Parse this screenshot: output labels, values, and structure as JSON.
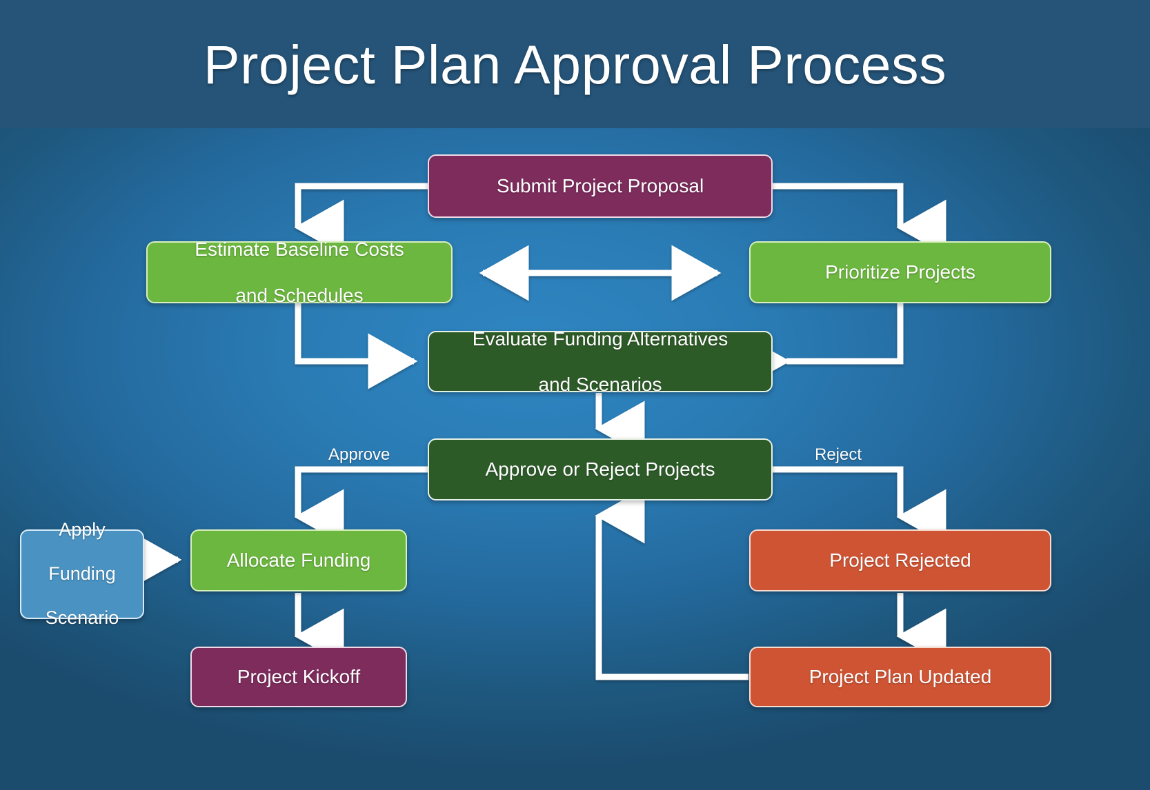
{
  "header": {
    "title": "Project Plan Approval Process",
    "band_color": "#255478",
    "title_color": "#ffffff"
  },
  "canvas": {
    "background_color": "#2a7bb4",
    "connector_color": "#ffffff"
  },
  "palette": {
    "purple": "#7d2c5c",
    "green": "#6cb73f",
    "dark_green": "#2d5b28",
    "orange": "#cf5434",
    "light_blue": "#4a92c2"
  },
  "nodes": [
    {
      "id": "submit",
      "label": "Submit Project Proposal",
      "color_key": "purple"
    },
    {
      "id": "estimate",
      "label": "Estimate Baseline Costs\nand Schedules",
      "color_key": "green"
    },
    {
      "id": "prioritize",
      "label": "Prioritize Projects",
      "color_key": "green"
    },
    {
      "id": "evaluate",
      "label": "Evaluate Funding Alternatives\nand Scenarios",
      "color_key": "dark_green"
    },
    {
      "id": "decide",
      "label": "Approve or Reject Projects",
      "color_key": "dark_green"
    },
    {
      "id": "scenario",
      "label": "Apply\nFunding\nScenario",
      "color_key": "light_blue"
    },
    {
      "id": "allocate",
      "label": "Allocate Funding",
      "color_key": "green"
    },
    {
      "id": "kickoff",
      "label": "Project Kickoff",
      "color_key": "purple"
    },
    {
      "id": "rejected",
      "label": "Project Rejected",
      "color_key": "orange"
    },
    {
      "id": "updated",
      "label": "Project Plan Updated",
      "color_key": "orange"
    }
  ],
  "node_labels": {
    "submit": "Submit Project Proposal",
    "estimate_line1": "Estimate Baseline Costs",
    "estimate_line2": "and Schedules",
    "prioritize": "Prioritize Projects",
    "evaluate_line1": "Evaluate Funding Alternatives",
    "evaluate_line2": "and Scenarios",
    "decide": "Approve or Reject Projects",
    "scenario_line1": "Apply",
    "scenario_line2": "Funding",
    "scenario_line3": "Scenario",
    "allocate": "Allocate Funding",
    "kickoff": "Project Kickoff",
    "rejected": "Project Rejected",
    "updated": "Project Plan Updated"
  },
  "edge_labels": {
    "approve": "Approve",
    "reject": "Reject"
  },
  "edges": [
    {
      "from": "submit",
      "to": "estimate",
      "style": "elbow-left-down",
      "arrow": "single"
    },
    {
      "from": "submit",
      "to": "prioritize",
      "style": "elbow-right-down",
      "arrow": "single"
    },
    {
      "from": "estimate",
      "to": "prioritize",
      "style": "horizontal",
      "arrow": "double"
    },
    {
      "from": "estimate",
      "to": "evaluate",
      "style": "elbow-down-right",
      "arrow": "single"
    },
    {
      "from": "prioritize",
      "to": "evaluate",
      "style": "elbow-down-left",
      "arrow": "single"
    },
    {
      "from": "evaluate",
      "to": "decide",
      "style": "vertical",
      "arrow": "single"
    },
    {
      "from": "decide",
      "to": "allocate",
      "style": "elbow-left-down",
      "arrow": "single",
      "label": "Approve"
    },
    {
      "from": "decide",
      "to": "rejected",
      "style": "elbow-right-down",
      "arrow": "single",
      "label": "Reject"
    },
    {
      "from": "scenario",
      "to": "allocate",
      "style": "horizontal",
      "arrow": "single"
    },
    {
      "from": "allocate",
      "to": "kickoff",
      "style": "vertical",
      "arrow": "single"
    },
    {
      "from": "rejected",
      "to": "updated",
      "style": "vertical",
      "arrow": "single"
    },
    {
      "from": "updated",
      "to": "decide",
      "style": "elbow-left-up",
      "arrow": "single"
    }
  ]
}
